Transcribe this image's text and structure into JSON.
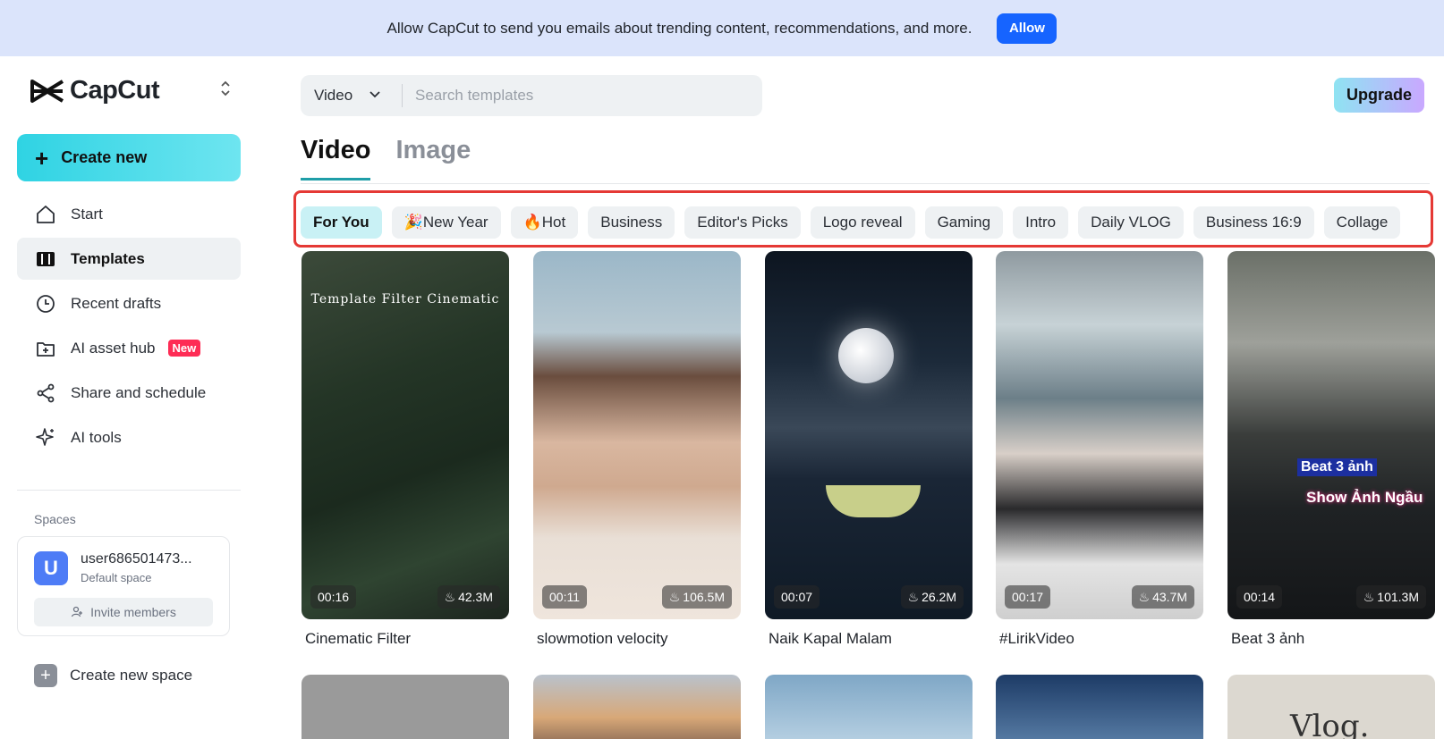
{
  "banner": {
    "text": "Allow CapCut to send you emails about trending content, recommendations, and more.",
    "allow_label": "Allow"
  },
  "sidebar": {
    "logo": "CapCut",
    "create_label": "Create new",
    "items": [
      {
        "label": "Start",
        "icon": "home-icon"
      },
      {
        "label": "Templates",
        "icon": "templates-icon",
        "active": true
      },
      {
        "label": "Recent drafts",
        "icon": "clock-icon"
      },
      {
        "label": "AI asset hub",
        "icon": "asset-hub-icon",
        "badge": "New"
      },
      {
        "label": "Share and schedule",
        "icon": "share-icon"
      },
      {
        "label": "AI tools",
        "icon": "sparkle-icon"
      }
    ],
    "spaces_label": "Spaces",
    "space": {
      "avatar": "U",
      "name": "user686501473...",
      "subtitle": "Default space",
      "invite_label": "Invite members"
    },
    "create_space_label": "Create new space"
  },
  "search": {
    "type": "Video",
    "placeholder": "Search templates"
  },
  "upgrade_label": "Upgrade",
  "tabs": [
    {
      "label": "Video",
      "active": true
    },
    {
      "label": "Image",
      "active": false
    }
  ],
  "chips": [
    {
      "label": "For You",
      "active": true
    },
    {
      "label": "🎉New Year"
    },
    {
      "label": "🔥Hot"
    },
    {
      "label": "Business"
    },
    {
      "label": "Editor's Picks"
    },
    {
      "label": "Logo reveal"
    },
    {
      "label": "Gaming"
    },
    {
      "label": "Intro"
    },
    {
      "label": "Daily VLOG"
    },
    {
      "label": "Business 16:9"
    },
    {
      "label": "Collage"
    }
  ],
  "cards": [
    {
      "title": "Cinematic Filter",
      "duration": "00:16",
      "views": "42.3M",
      "overlay": "Template Filter Cinematic"
    },
    {
      "title": "slowmotion velocity",
      "duration": "00:11",
      "views": "106.5M"
    },
    {
      "title": "Naik Kapal Malam",
      "duration": "00:07",
      "views": "26.2M"
    },
    {
      "title": "#LirikVideo",
      "duration": "00:17",
      "views": "43.7M"
    },
    {
      "title": "Beat 3 ảnh",
      "duration": "00:14",
      "views": "101.3M",
      "overlay": "Beat 3 ảnh",
      "overlay2": "Show Ảnh Ngầu"
    }
  ],
  "row2_overlay": "Vlog.",
  "colors": {
    "accent": "#2fd3e3",
    "allow": "#1664ff",
    "badge": "#fe2c55",
    "highlight_box": "#e53935"
  }
}
